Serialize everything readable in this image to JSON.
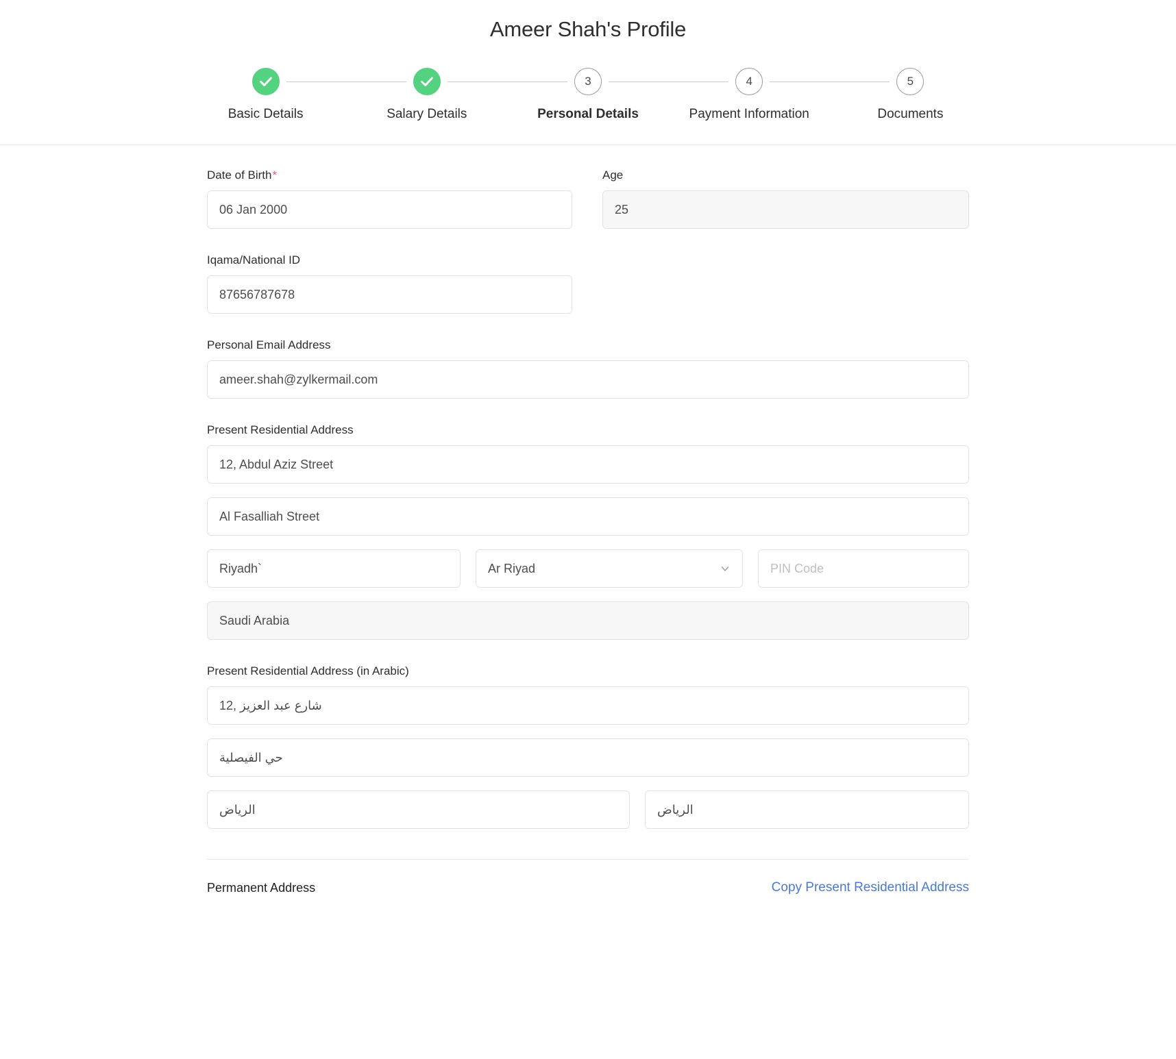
{
  "header": {
    "title": "Ameer Shah's Profile"
  },
  "stepper": {
    "steps": [
      {
        "label": "Basic Details",
        "marker": "check",
        "state": "done"
      },
      {
        "label": "Salary Details",
        "marker": "check",
        "state": "done"
      },
      {
        "label": "Personal Details",
        "marker": "3",
        "state": "active"
      },
      {
        "label": "Payment Information",
        "marker": "4",
        "state": "upcoming"
      },
      {
        "label": "Documents",
        "marker": "5",
        "state": "upcoming"
      }
    ],
    "done_color": "#55d27f",
    "line_color": "#c9c9c9"
  },
  "form": {
    "date_of_birth": {
      "label": "Date of Birth",
      "required_mark": "*",
      "value": "06 Jan 2000"
    },
    "age": {
      "label": "Age",
      "value": "25"
    },
    "iqama": {
      "label": "Iqama/National ID",
      "value": "87656787678"
    },
    "personal_email": {
      "label": "Personal Email Address",
      "value": "ameer.shah@zylkermail.com"
    },
    "present_address": {
      "label": "Present Residential Address",
      "line1": "12, Abdul Aziz Street",
      "line2": "Al Fasalliah Street",
      "city": "Riyadh`",
      "state": "Ar Riyad",
      "pin_placeholder": "PIN Code",
      "pin_value": "",
      "country": "Saudi Arabia"
    },
    "present_address_arabic": {
      "label": "Present Residential Address (in Arabic)",
      "line1": "12, شارع عبد العزيز",
      "line2": "حي الفيصلية",
      "city": "الرياض",
      "state": "الرياض"
    },
    "permanent_address": {
      "title": "Permanent Address",
      "copy_link": "Copy Present Residential Address",
      "link_color": "#4a7ad1"
    }
  }
}
